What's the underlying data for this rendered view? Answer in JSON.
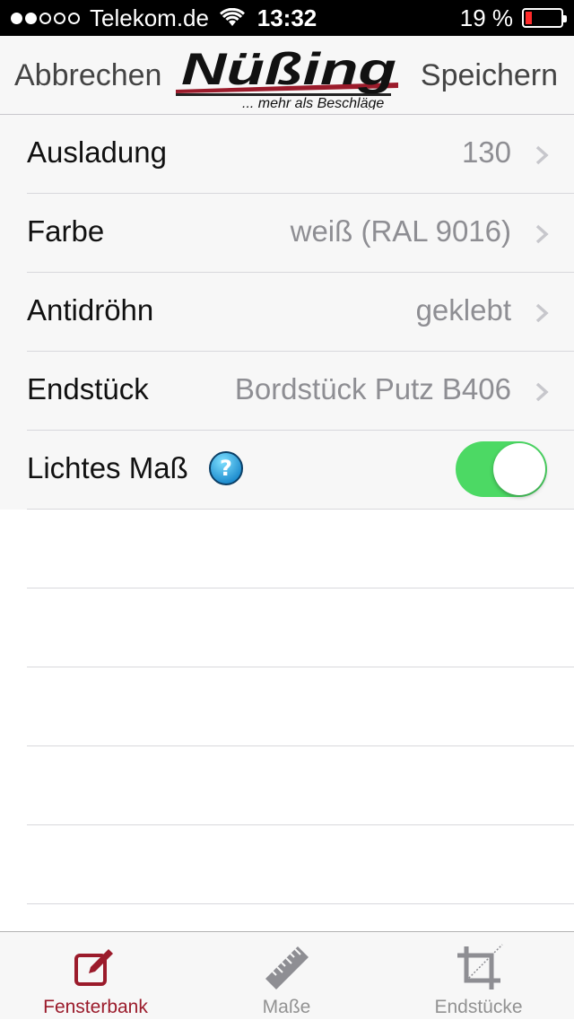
{
  "status_bar": {
    "carrier": "Telekom.de",
    "signal_bars_filled": 2,
    "signal_bars_total": 5,
    "time": "13:32",
    "battery_percent_text": "19 %",
    "battery_level": 0.19,
    "battery_color": "#ff2a2a"
  },
  "nav": {
    "cancel_label": "Abbrechen",
    "save_label": "Speichern",
    "logo": {
      "name": "Nüßing",
      "tagline": "... mehr als Beschläge"
    }
  },
  "settings": {
    "rows": [
      {
        "label": "Ausladung",
        "value": "130"
      },
      {
        "label": "Farbe",
        "value": "weiß (RAL 9016)"
      },
      {
        "label": "Antidröhn",
        "value": "geklebt"
      },
      {
        "label": "Endstück",
        "value": "Bordstück Putz B406"
      }
    ],
    "toggle_row": {
      "label": "Lichtes Maß",
      "help_icon": "question-mark-help-icon",
      "on": true,
      "accent": "#4cd964"
    }
  },
  "tab_bar": {
    "tabs": [
      {
        "label": "Fensterbank",
        "icon": "edit-icon",
        "active": true
      },
      {
        "label": "Maße",
        "icon": "ruler-icon",
        "active": false
      },
      {
        "label": "Endstücke",
        "icon": "crop-icon",
        "active": false
      }
    ],
    "active_color": "#9b1b2b",
    "inactive_color": "#929292"
  }
}
